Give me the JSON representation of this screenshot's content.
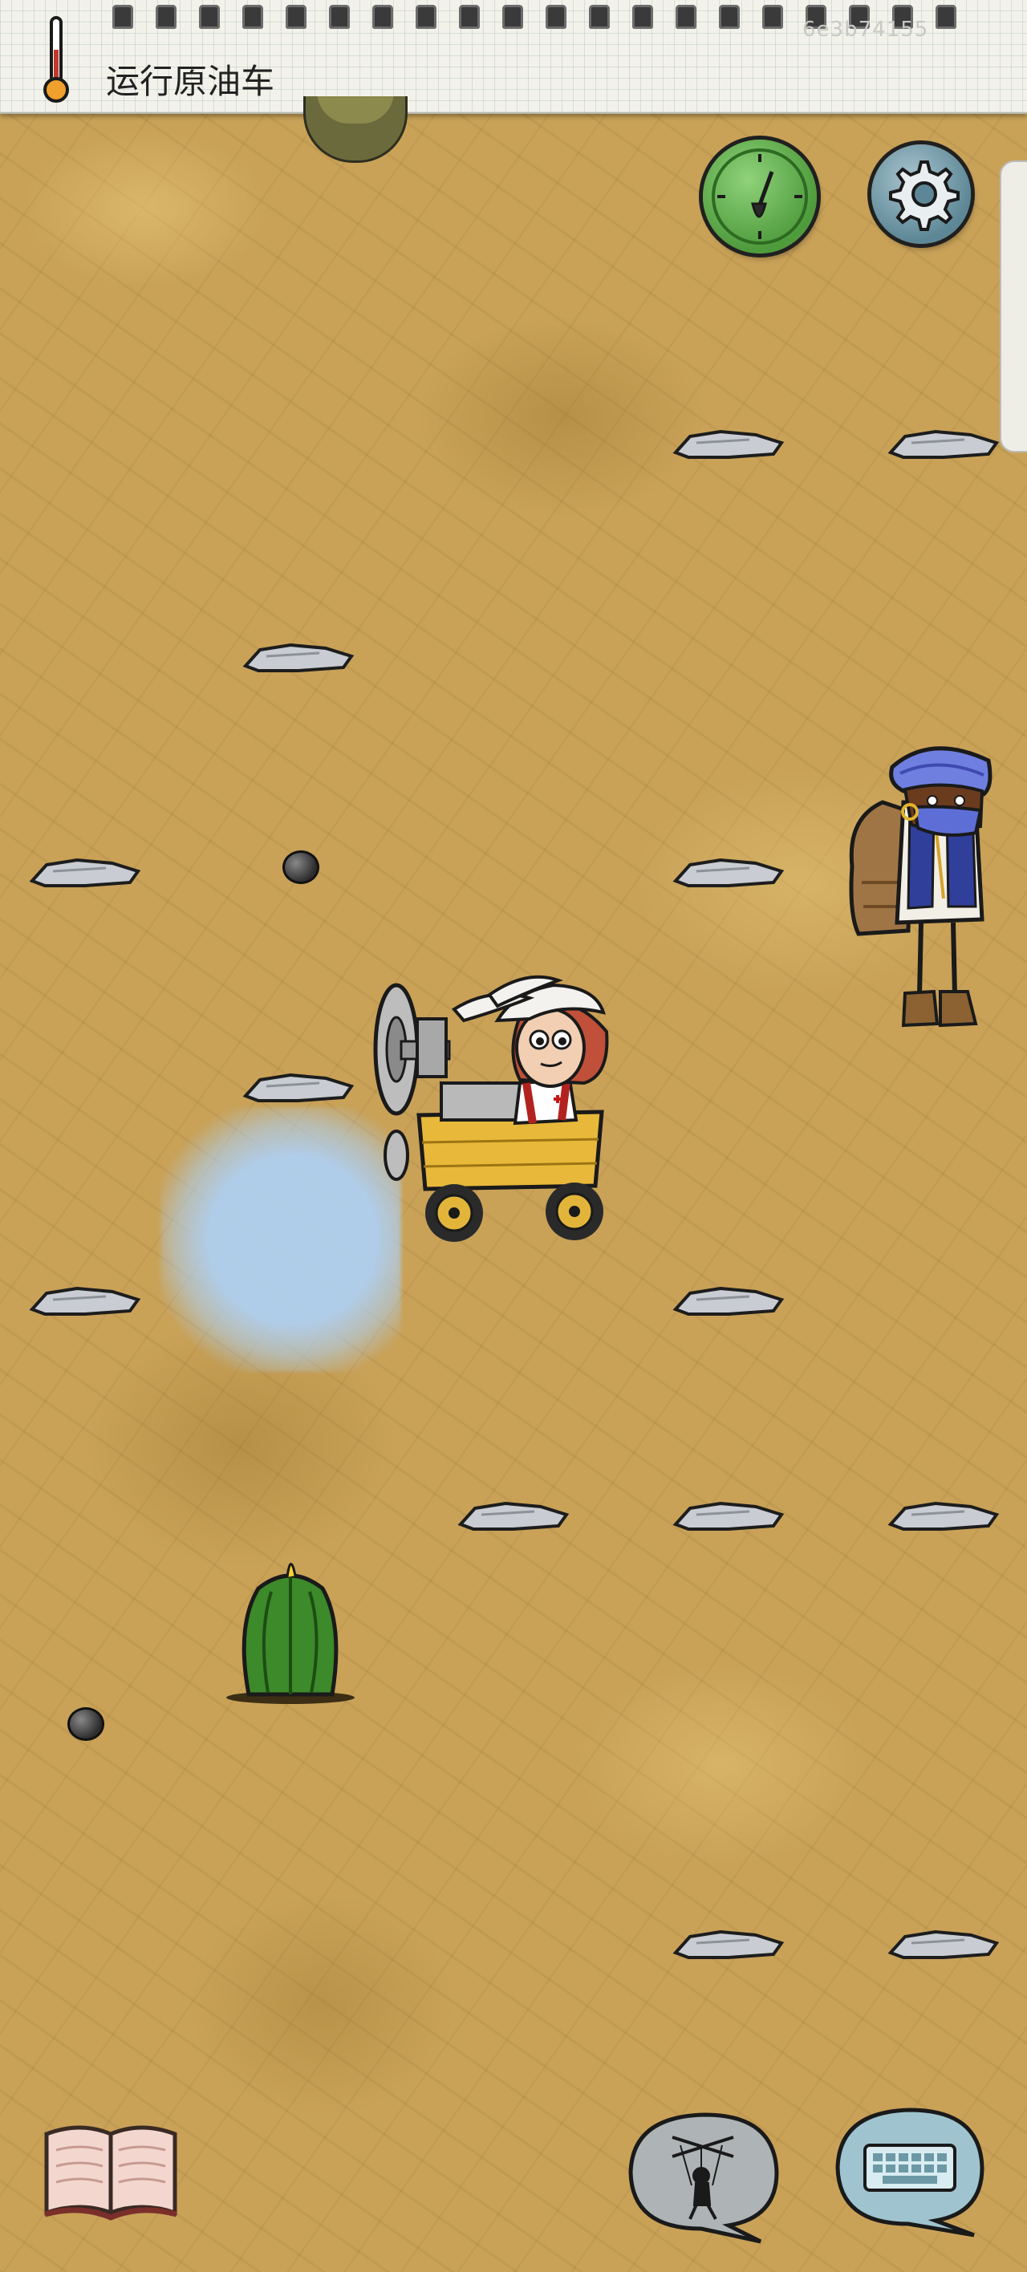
{
  "topbar": {
    "status_text": "运行原油车",
    "faint_id": "6e3b74155",
    "binding_hole_count": 20
  },
  "icons": {
    "thermometer": "thermometer-icon",
    "day_night": "moon-icon",
    "compass": "compass-icon",
    "settings": "gear-icon",
    "journal": "open-book-icon",
    "puppet": "puppet-icon",
    "keyboard": "keyboard-icon"
  },
  "colors": {
    "paper": "#f3f2ea",
    "desert": "#c9a258",
    "compass_green": "#4e9b3c",
    "settings_blue": "#5d8796",
    "smoke": "#afcdeb",
    "cactus_green": "#3c8a2a"
  }
}
